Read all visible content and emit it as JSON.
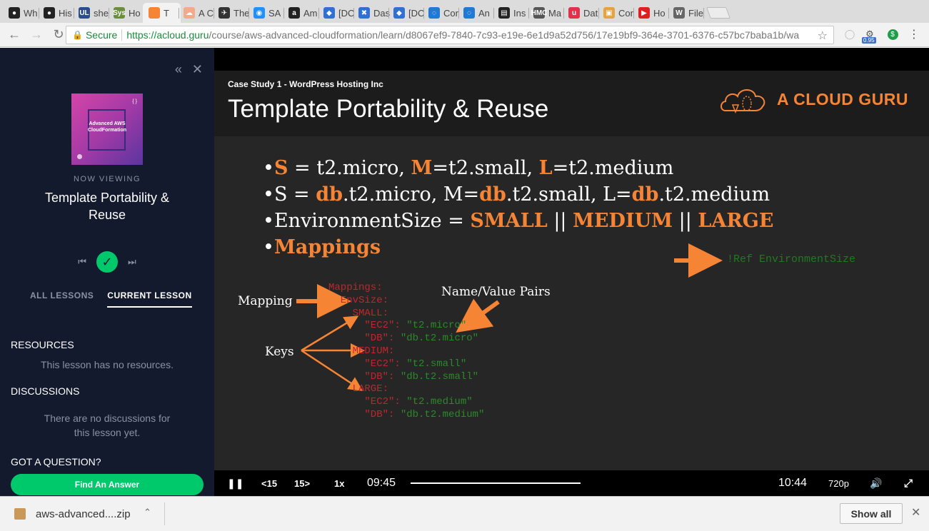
{
  "tabs": [
    {
      "fav": "github-icon",
      "color": "#222222",
      "glyph": "●",
      "title": "Wh"
    },
    {
      "fav": "github-icon",
      "color": "#222222",
      "glyph": "●",
      "title": "His"
    },
    {
      "fav": "ul-icon",
      "color": "#2a4d8f",
      "glyph": "UL",
      "title": "she"
    },
    {
      "fav": "sys-icon",
      "color": "#6a8f3a",
      "glyph": "Sys",
      "title": "Ho"
    },
    {
      "fav": "acloudguru-icon",
      "color": "#f58535",
      "glyph": "",
      "title": "T"
    },
    {
      "fav": "cloud-icon",
      "color": "#f7a78a",
      "glyph": "☁",
      "title": "A C"
    },
    {
      "fav": "tool-icon",
      "color": "#333333",
      "glyph": "✈",
      "title": "The"
    },
    {
      "fav": "globe-icon",
      "color": "#1e90ff",
      "glyph": "◉",
      "title": "SA"
    },
    {
      "fav": "amazon-icon",
      "color": "#222222",
      "glyph": "a",
      "title": "Am"
    },
    {
      "fav": "diamond-icon",
      "color": "#2f6fd6",
      "glyph": "◆",
      "title": "[DC"
    },
    {
      "fav": "dash-icon",
      "color": "#2f6fd6",
      "glyph": "✖",
      "title": "Das"
    },
    {
      "fav": "diamond-icon",
      "color": "#2f6fd6",
      "glyph": "◆",
      "title": "[DC"
    },
    {
      "fav": "circle-icon",
      "color": "#1e7ad6",
      "glyph": "◌",
      "title": "Cor"
    },
    {
      "fav": "circle-icon",
      "color": "#1e7ad6",
      "glyph": "◌",
      "title": "An"
    },
    {
      "fav": "book-icon",
      "color": "#222222",
      "glyph": "▤",
      "title": "Ins"
    },
    {
      "fav": "hmc-icon",
      "color": "#555555",
      "glyph": "HMC",
      "title": "Ma"
    },
    {
      "fav": "udemy-icon",
      "color": "#e0334b",
      "glyph": "u",
      "title": "Dat"
    },
    {
      "fav": "box-icon",
      "color": "#e8a23a",
      "glyph": "▣",
      "title": "Cor"
    },
    {
      "fav": "youtube-icon",
      "color": "#e02020",
      "glyph": "▶",
      "title": "Ho"
    },
    {
      "fav": "wikipedia-icon",
      "color": "#666666",
      "glyph": "W",
      "title": "File"
    }
  ],
  "address": {
    "secure_label": "Secure",
    "url_host": "https://acloud.guru",
    "url_path": "/course/aws-advanced-cloudformation/learn/d8067ef9-7840-7c93-e19e-6e1d9a52d756/17e19bf9-364e-3701-6376-c57bc7baba1b/wa",
    "ext_badge": "0.95"
  },
  "sidebar": {
    "cover_title": "Advanced AWS CloudFormation",
    "now_viewing": "NOW VIEWING",
    "lesson_title": "Template Portability & Reuse",
    "tab_all": "ALL LESSONS",
    "tab_current": "CURRENT LESSON",
    "resources_heading": "RESOURCES",
    "resources_text": "This lesson has no resources.",
    "discussions_heading": "DISCUSSIONS",
    "discussions_text_1": "There are no discussions for",
    "discussions_text_2": "this lesson yet.",
    "question_heading": "GOT A QUESTION?",
    "find_button": "Find An Answer"
  },
  "slide": {
    "case_study": "Case Study 1 - WordPress Hosting Inc",
    "title": "Template Portability & Reuse",
    "brand": "A CLOUD GURU",
    "bullet1": {
      "a": "S",
      "b": " = t2.micro, ",
      "c": "M",
      "d": "=t2.small, ",
      "e": "L",
      "f": "=t2.medium"
    },
    "bullet2": {
      "a": "S = ",
      "b": "db",
      "c": ".t2.micro, M=",
      "d": "db",
      "e": ".t2.small, L=",
      "f": "db",
      "g": ".t2.medium"
    },
    "bullet3": {
      "a": "EnvironmentSize = ",
      "b": "SMALL",
      "c": " || ",
      "d": "MEDIUM",
      "e": " || ",
      "f": "LARGE"
    },
    "bullet4": "Mappings",
    "ref": "!Ref EnvironmentSize",
    "label_mapping": "Mapping",
    "label_pairs": "Name/Value Pairs",
    "label_keys": "Keys",
    "code": {
      "l1": "Mappings:",
      "l2": "  EnvSize:",
      "l3": "    SMALL:",
      "l4k": "      \"EC2\": ",
      "l4v": "\"t2.micro\"",
      "l5k": "      \"DB\": ",
      "l5v": "\"db.t2.micro\"",
      "l6": "    MEDIUM:",
      "l7k": "      \"EC2\": ",
      "l7v": "\"t2.small\"",
      "l8k": "      \"DB\": ",
      "l8v": "\"db.t2.small\"",
      "l9": "    LARGE:",
      "l10k": "      \"EC2\": ",
      "l10v": "\"t2.medium\"",
      "l11k": "      \"DB\": ",
      "l11v": "\"db.t2.medium\""
    }
  },
  "player": {
    "skip_back": "15",
    "skip_fwd": "15",
    "speed": "1x",
    "elapsed": "09:45",
    "duration": "10:44",
    "quality": "720p",
    "progress_fraction": 0.908
  },
  "downloads": {
    "file": "aws-advanced....zip",
    "show_all": "Show all"
  },
  "colors": {
    "accent_orange": "#f58535",
    "accent_green": "#00c96b",
    "sidebar_bg": "#131a2e"
  }
}
